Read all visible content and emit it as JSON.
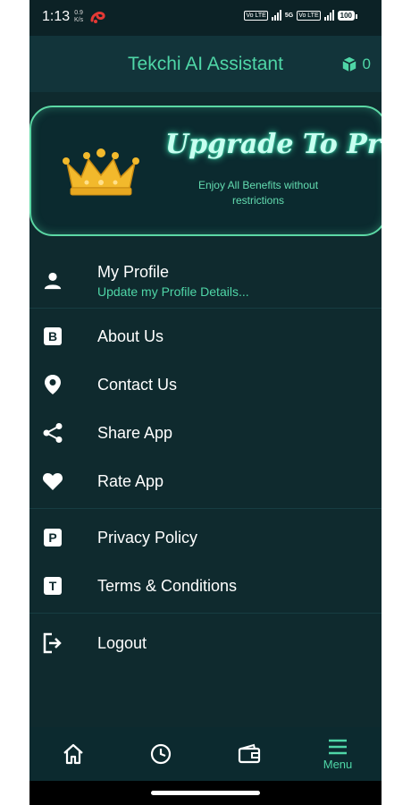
{
  "status_bar": {
    "time": "1:13",
    "net_speed_value": "0.9",
    "net_speed_unit": "K/s",
    "volte1": "Vo LTE",
    "five_g": "5G",
    "volte2": "Vo LTE",
    "battery": "100"
  },
  "header": {
    "title": "Tekchi AI Assistant",
    "credits": "0"
  },
  "promo": {
    "title": "Upgrade To Pro",
    "subtitle": "Enjoy All Benefits without restrictions"
  },
  "menu": {
    "profile_label": "My Profile",
    "profile_sub": "Update my Profile Details...",
    "about_badge": "B",
    "about_label": "About Us",
    "contact_label": "Contact Us",
    "share_label": "Share App",
    "rate_label": "Rate App",
    "privacy_badge": "P",
    "privacy_label": "Privacy Policy",
    "terms_badge": "T",
    "terms_label": "Terms & Conditions",
    "logout_label": "Logout"
  },
  "bottom_nav": {
    "active_label": "Menu"
  },
  "colors": {
    "background": "#0f2a2e",
    "accent": "#4fd6a7",
    "text": "#ffffff"
  },
  "icons": [
    "person-icon",
    "b-badge-icon",
    "location-pin-icon",
    "share-icon",
    "heart-icon",
    "p-badge-icon",
    "t-badge-icon",
    "logout-icon",
    "home-icon",
    "clock-icon",
    "wallet-icon",
    "menu-icon",
    "cube-icon",
    "crown-icon"
  ]
}
